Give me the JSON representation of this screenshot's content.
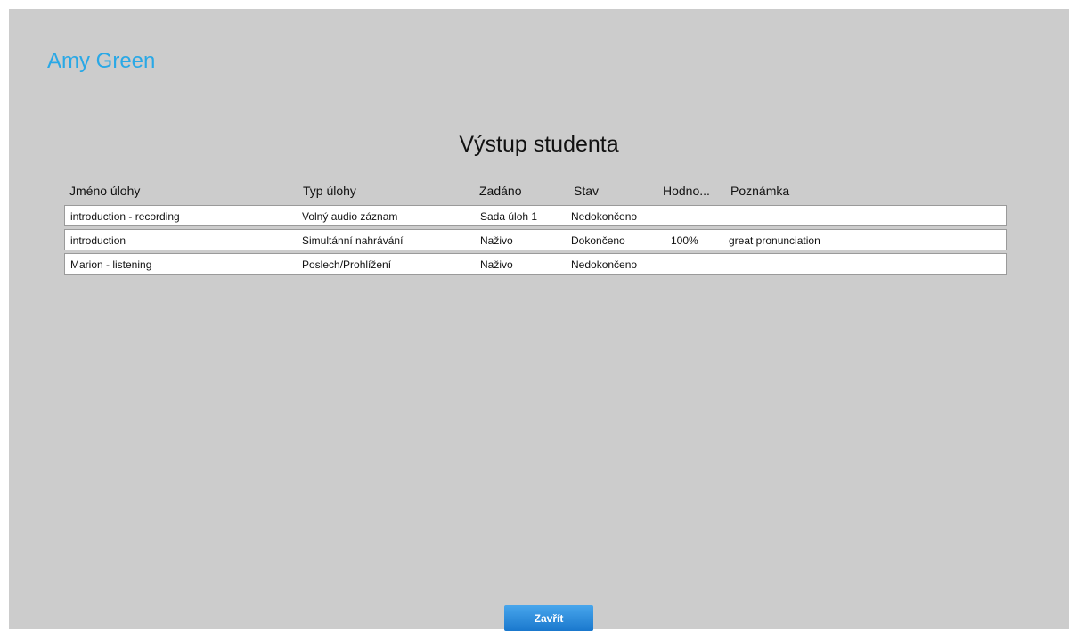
{
  "student": {
    "name": "Amy Green"
  },
  "title": "Výstup studenta",
  "table": {
    "columns": {
      "name": "Jméno úlohy",
      "type": "Typ úlohy",
      "assigned": "Zadáno",
      "status": "Stav",
      "grade": "Hodno...",
      "note": "Poznámka"
    },
    "rows": [
      {
        "name": "introduction - recording",
        "type": "Volný audio záznam",
        "assigned": "Sada úloh 1",
        "status": "Nedokončeno",
        "grade": "",
        "note": ""
      },
      {
        "name": "introduction",
        "type": "Simultánní nahrávání",
        "assigned": "Naživo",
        "status": "Dokončeno",
        "grade": "100%",
        "note": "great pronunciation"
      },
      {
        "name": "Marion - listening",
        "type": "Poslech/Prohlížení",
        "assigned": "Naživo",
        "status": "Nedokončeno",
        "grade": "",
        "note": ""
      }
    ]
  },
  "buttons": {
    "close_label": "Zavřít"
  },
  "colors": {
    "background": "#cccccc",
    "student_name": "#29a8e6",
    "button": "#2b8ee0"
  }
}
